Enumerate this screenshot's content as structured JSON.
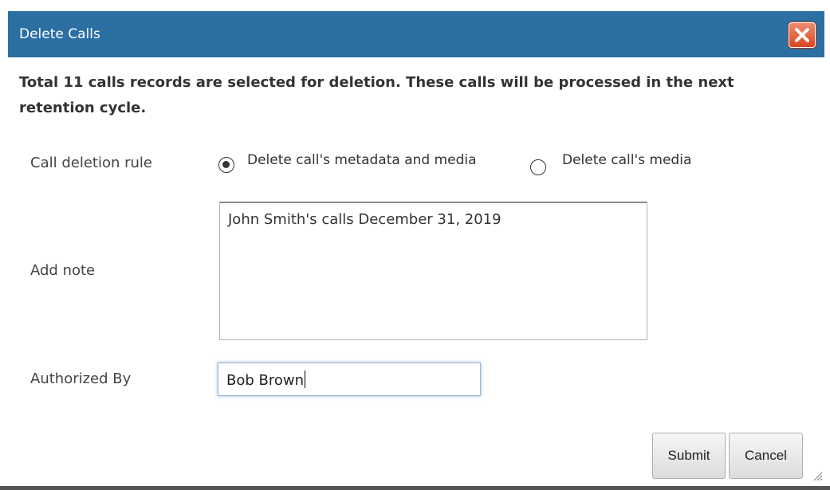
{
  "dialog": {
    "title": "Delete Calls",
    "close_icon": "close-icon",
    "message": "Total 11 calls records are selected for deletion. These calls will be processed in the next retention cycle."
  },
  "form": {
    "deletion_rule": {
      "label": "Call deletion rule",
      "options": [
        {
          "label": "Delete call's metadata and media",
          "selected": true
        },
        {
          "label": "Delete call's media",
          "selected": false
        }
      ]
    },
    "note": {
      "label": "Add note",
      "value": "John Smith's calls December 31, 2019"
    },
    "authorized_by": {
      "label": "Authorized By",
      "value": "Bob Brown"
    }
  },
  "buttons": {
    "submit": "Submit",
    "cancel": "Cancel"
  },
  "colors": {
    "titlebar": "#2c6fa3",
    "close_button": "#d9461f"
  }
}
